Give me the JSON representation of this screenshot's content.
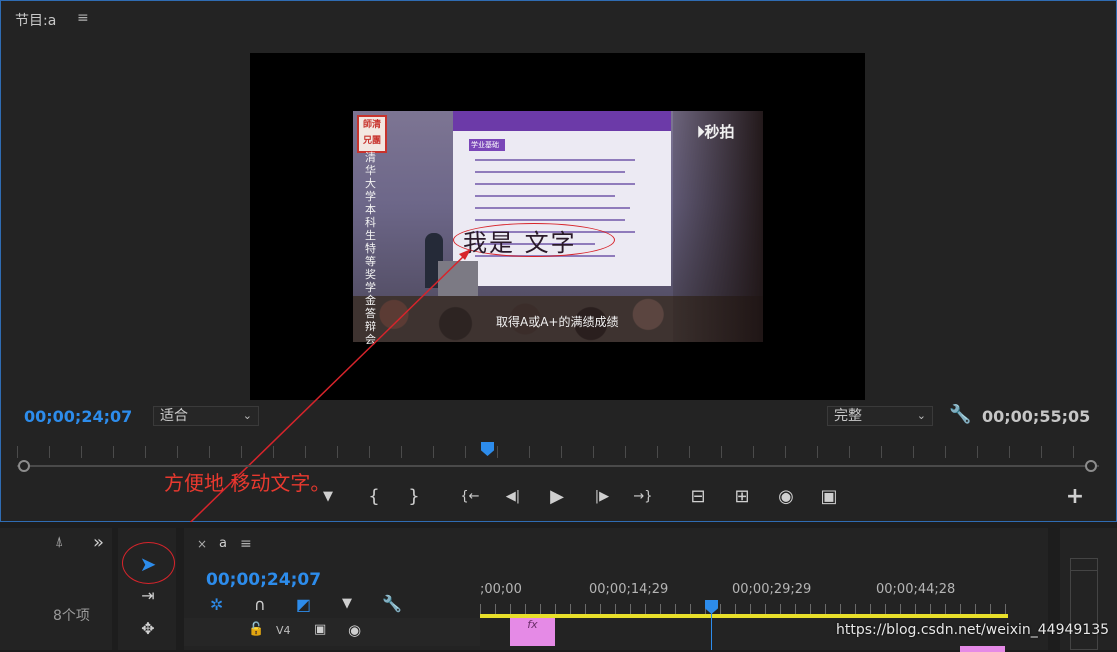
{
  "program": {
    "title": "节目:a",
    "menu_glyph": "≡",
    "timecode_current": "00;00;24;07",
    "fit_select": "适合",
    "quality_select": "完整",
    "timecode_duration": "00;00;55;05"
  },
  "video": {
    "overlay_text": "我是 文字",
    "subtitle": "取得A或A+的满绩成绩",
    "logo": "秒拍",
    "vertical_caption": "清华大学本科生特等奖学金答辩会",
    "seal_text": "師清兄團",
    "slide_label": "学业基础"
  },
  "annotation": {
    "text": "方便地 移动文字。",
    "color": "#e8392f"
  },
  "controls": {
    "marker": "▼",
    "in": "{",
    "out": "}",
    "go_in": "{←",
    "step_back": "◀|",
    "play": "▶",
    "step_fwd": "|▶",
    "go_out": "→}",
    "lift": "⊟",
    "extract": "⊞",
    "camera": "◉",
    "compare": "▣",
    "add": "+"
  },
  "project_panel": {
    "expand": "»",
    "item_count": "8个项"
  },
  "sequence": {
    "close": "×",
    "name": "a",
    "menu_glyph": "≡",
    "timecode": "00;00;24;07",
    "ticks": [
      ";00;00",
      "00;00;14;29",
      "00;00;29;29",
      "00;00;44;28"
    ],
    "track": "V4",
    "clip_label": "fx"
  },
  "watermark": "https://blog.csdn.net/weixin_44949135",
  "colors": {
    "accent": "#2d8ceb",
    "annotation": "#d7242b",
    "clip": "#e58ae6",
    "work_area": "#e8df2a"
  }
}
